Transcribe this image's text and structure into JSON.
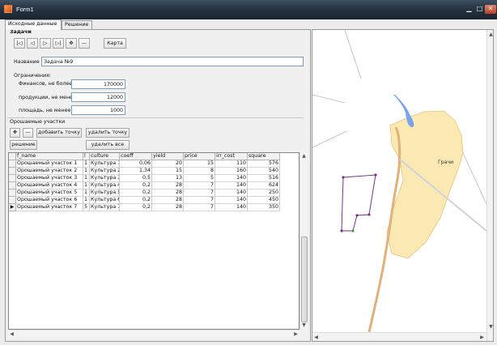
{
  "window": {
    "title": "Form1"
  },
  "tabs": [
    "Исходные данные",
    "Решение"
  ],
  "task_group": {
    "title": "Задачи",
    "nav": [
      "|◁",
      "◁",
      "▷",
      "▷|",
      "✥",
      "—"
    ],
    "map_button": "Карта",
    "name_label": "Название",
    "name_value": "Задача №9"
  },
  "constraints": {
    "title": "Ограничения:",
    "rows": [
      {
        "label": "Финансов, не более",
        "value": "170000"
      },
      {
        "label": "продукции, не менее",
        "value": "12000"
      },
      {
        "label": "площадь, не менее",
        "value": "1000"
      }
    ]
  },
  "plots": {
    "title": "Орошаемые участки",
    "add_icon": "✥",
    "remove_icon": "—",
    "add_point": "добавить точку",
    "delete_point": "удалить точку",
    "solve": "решение",
    "delete_all": "удалить все"
  },
  "grid": {
    "columns": [
      "f_name",
      "l",
      "culture",
      "coeff",
      "yield",
      "price",
      "irr_cost",
      "square"
    ],
    "rows": [
      [
        "Орошаемый участок 1",
        "1",
        "Культура 1",
        "0,06",
        "20",
        "15",
        "110",
        "576"
      ],
      [
        "Орошаемый участок 2",
        "1",
        "Культура 2",
        "1,34",
        "15",
        "8",
        "160",
        "540"
      ],
      [
        "Орошаемый участок 3",
        "1",
        "Культура 3",
        "0,5",
        "13",
        "5",
        "140",
        "516"
      ],
      [
        "Орошаемый участок 4",
        "1",
        "Культура 4",
        "0,2",
        "28",
        "7",
        "140",
        "624"
      ],
      [
        "Орошаемый участок 5",
        "1",
        "Культура 5",
        "0,2",
        "28",
        "7",
        "140",
        "250"
      ],
      [
        "Орошаемый участок 6",
        "1",
        "Культура 6",
        "0,2",
        "28",
        "7",
        "140",
        "450"
      ],
      [
        "Орошаемый участок 7",
        "5",
        "Культура 7",
        "0,2",
        "28",
        "7",
        "140",
        "350"
      ]
    ],
    "current_row_marker": "▶",
    "current_row": 6
  },
  "map": {
    "village_label": "Грачи",
    "colors": {
      "village": "#fbe9b4",
      "water": "#7aa5ee",
      "road": "#e2b07a",
      "polygon": "#7a2f8c"
    }
  },
  "icons": [
    "app-icon",
    "minimize-icon",
    "maximize-icon",
    "close-icon",
    "scroll-left-icon",
    "scroll-right-icon",
    "scroll-up-icon",
    "scroll-down-icon"
  ]
}
